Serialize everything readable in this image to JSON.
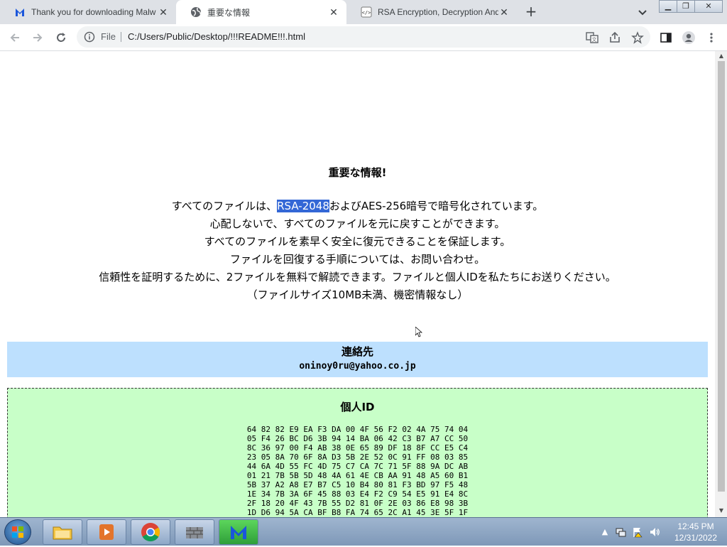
{
  "tabs": [
    {
      "label": "Thank you for downloading Malw",
      "icon": "malwarebytes-icon",
      "active": false
    },
    {
      "label": "重要な情報",
      "icon": "globe-icon",
      "active": true
    },
    {
      "label": "RSA Encryption, Decryption And",
      "icon": "code-icon",
      "active": false
    }
  ],
  "toolbar": {
    "scheme": "File",
    "url": "C:/Users/Public/Desktop/!!!README!!!.html"
  },
  "page": {
    "title": "重要な情報!",
    "line1_pre": "すべてのファイルは、",
    "line1_sel": "RSA-2048",
    "line1_post": "およびAES-256暗号で暗号化されています。",
    "line2": "心配しないで、すべてのファイルを元に戻すことができます。",
    "line3": "すべてのファイルを素早く安全に復元できることを保証します。",
    "line4": "ファイルを回復する手順については、お問い合わせ。",
    "line5": "信頼性を証明するために、2ファイルを無料で解読できます。ファイルと個人IDを私たちにお送りください。",
    "line6": "（ファイルサイズ10MB未満、機密情報なし）",
    "contact_heading": "連絡先",
    "contact_email": "oninoy0ru@yahoo.co.jp",
    "id_heading": "個人ID",
    "id_hex": "64 82 82 E9 EA F3 DA 00 4F 56 F2 02 4A 75 74 04\n05 F4 26 BC D6 3B 94 14 BA 06 42 C3 B7 A7 CC 50\n8C 36 97 00 F4 AB 38 0E 65 89 DF 18 8F CC E5 C4\n23 05 8A 70 6F 8A D3 5B 2E 52 0C 91 FF 08 03 85\n44 6A 4D 55 FC 4D 75 C7 CA 7C 71 5F 88 9A DC AB\n01 21 7B 5B 5D 48 4A 61 4E CB AA 91 48 A5 60 B1\n5B 37 A2 A8 E7 B7 C5 10 B4 80 81 F3 BD 97 F5 48\n1E 34 7B 3A 6F 45 88 03 E4 F2 C9 54 E5 91 E4 8C\n2F 18 20 4F 43 7B 55 D2 81 0F 2E 03 86 E8 98 3B\n1D D6 94 5A CA BF B8 FA 74 65 2C A1 45 3E 5F 1F"
  },
  "taskbar": {
    "time": "12:45 PM",
    "date": "12/31/2022",
    "apps": [
      "file-explorer-icon",
      "media-player-icon",
      "chrome-icon",
      "firewall-icon",
      "malwarebytes-icon"
    ]
  },
  "colors": {
    "contact_bg": "#bde0fe",
    "id_bg": "#c8ffc8",
    "selection": "#3367d6"
  }
}
